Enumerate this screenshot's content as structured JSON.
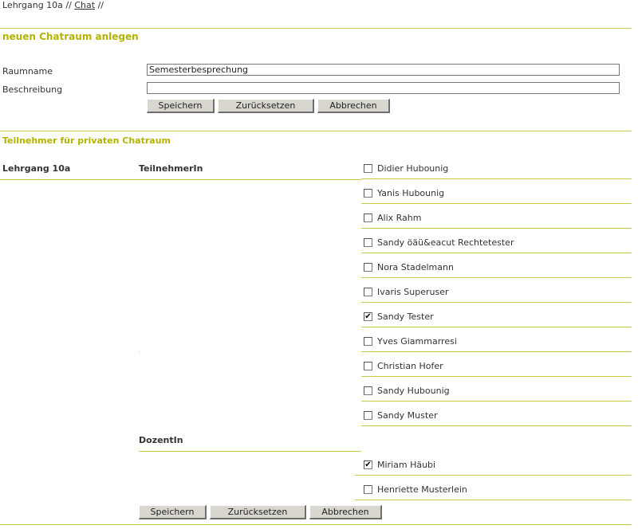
{
  "breadcrumb": {
    "course": "Lehrgang 10a",
    "sep1": "//",
    "chat": "Chat",
    "sep2": "//"
  },
  "form": {
    "title": "neuen Chatraum anlegen",
    "room_label": "Raumname",
    "room_value": "Semesterbesprechung",
    "desc_label": "Beschreibung",
    "desc_value": "",
    "save": "Speichern",
    "reset": "Zurücksetzen",
    "cancel": "Abbrechen"
  },
  "participants": {
    "title": "Teilnehmer für privaten Chatraum",
    "group": "Lehrgang 10a",
    "students_heading": "TeilnehmerIn",
    "students": [
      {
        "name": "Didier Hubounig",
        "checked": false
      },
      {
        "name": "Yanis Hubounig",
        "checked": false
      },
      {
        "name": "Alix Rahm",
        "checked": false
      },
      {
        "name": "Sandy öäü&eacut Rechtetester",
        "checked": false
      },
      {
        "name": "Nora Stadelmann",
        "checked": false
      },
      {
        "name": "Ivaris Superuser",
        "checked": false
      },
      {
        "name": "Sandy Tester",
        "checked": true
      },
      {
        "name": "Yves Giammarresi",
        "checked": false
      },
      {
        "name": "Christian Hofer",
        "checked": false
      },
      {
        "name": "Sandy Hubounig",
        "checked": false
      },
      {
        "name": "Sandy Muster",
        "checked": false
      }
    ],
    "teachers_heading": "DozentIn",
    "teachers": [
      {
        "name": "Miriam Häubi",
        "checked": true
      },
      {
        "name": "Henriette Musterlein",
        "checked": false
      }
    ]
  },
  "bottom_buttons": {
    "save": "Speichern",
    "reset": "Zurücksetzen",
    "cancel": "Abbrechen"
  },
  "colors": {
    "accent": "#b4b400",
    "rule": "#c8c84a"
  }
}
